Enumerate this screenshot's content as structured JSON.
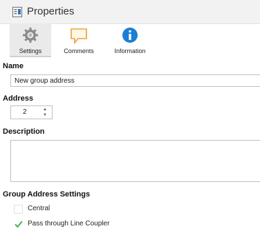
{
  "header": {
    "title": "Properties",
    "icon": "properties-doc-icon"
  },
  "tabs": [
    {
      "label": "Settings",
      "icon": "gear-icon",
      "active": true
    },
    {
      "label": "Comments",
      "icon": "comment-icon",
      "active": false
    },
    {
      "label": "Information",
      "icon": "info-icon",
      "active": false
    }
  ],
  "form": {
    "name_label": "Name",
    "name_value": "New group address",
    "address_label": "Address",
    "address_value": "2",
    "description_label": "Description",
    "description_value": "",
    "group_settings_label": "Group Address Settings",
    "checkboxes": [
      {
        "label": "Central",
        "checked": false
      },
      {
        "label": "Pass through Line Coupler",
        "checked": true
      }
    ]
  },
  "colors": {
    "accent_info": "#1a7fd4",
    "comment_orange": "#e8a33a",
    "check_green": "#4caf50"
  }
}
